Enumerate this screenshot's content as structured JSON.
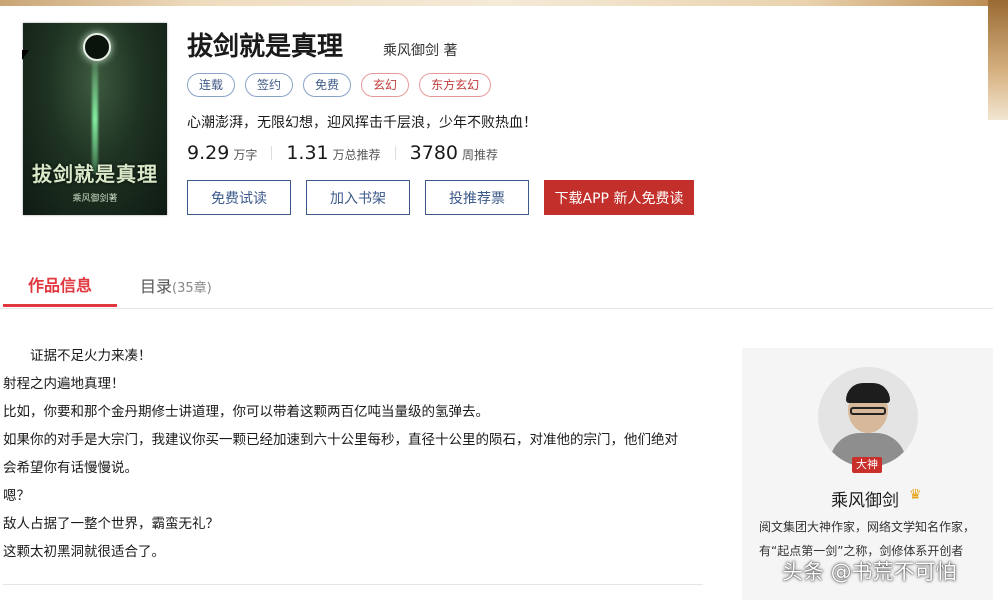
{
  "book": {
    "title": "拔剑就是真理",
    "author": "乘风御剑",
    "author_suffix": "著",
    "cover": {
      "title": "拔剑就是真理",
      "author": "乘风御剑著"
    },
    "tags": [
      {
        "label": "连载",
        "style": "blue"
      },
      {
        "label": "签约",
        "style": "blue"
      },
      {
        "label": "免费",
        "style": "blue"
      },
      {
        "label": "玄幻",
        "style": "red"
      },
      {
        "label": "东方玄幻",
        "style": "red"
      }
    ],
    "intro": "心潮澎湃，无限幻想，迎风挥击千层浪，少年不败热血！",
    "stats": [
      {
        "value": "9.29",
        "unit": "万字"
      },
      {
        "value": "1.31",
        "unit": "万总推荐"
      },
      {
        "value": "3780",
        "unit": "周推荐"
      }
    ]
  },
  "actions": {
    "trial_read": "免费试读",
    "add_shelf": "加入书架",
    "vote": "投推荐票",
    "download": "下载APP 新人免费读"
  },
  "tabs": {
    "info": "作品信息",
    "catalog": "目录",
    "catalog_count": "(35章)"
  },
  "description": [
    "证据不足火力来凑！",
    "射程之内遍地真理！",
    "比如，你要和那个金丹期修士讲道理，你可以带着这颗两百亿吨当量级的氢弹去。",
    "如果你的对手是大宗门，我建议你买一颗已经加速到六十公里每秒，直径十公里的陨石，对准他的宗门，他们绝对",
    "会希望你有话慢慢说。",
    "嗯？",
    "敌人占据了一整个世界，霸蛮无礼？",
    "这颗太初黑洞就很适合了。"
  ],
  "author_panel": {
    "badge": "大神",
    "name": "乘风御剑",
    "bio_line1": "阅文集团大神作家，网络文学知名作家，",
    "bio_line2": "有“起点第一剑”之称，剑修体系开创者"
  },
  "watermark": "头条 @书荒不可怕",
  "colors": {
    "accent_red": "#e0383e",
    "button_red": "#c32f2a",
    "button_blue": "#3c5a8a"
  }
}
